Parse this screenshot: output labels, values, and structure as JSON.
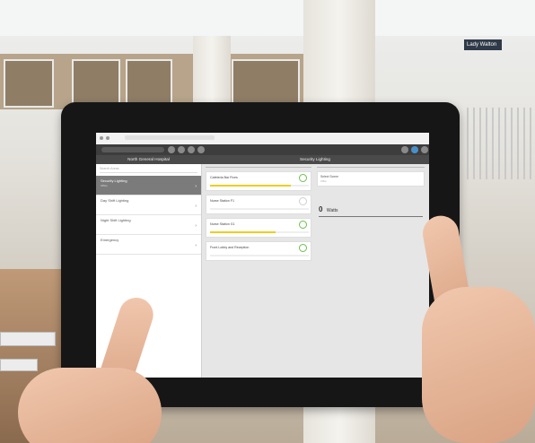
{
  "background_sign": "Lady Walton",
  "app": {
    "browser_url": "",
    "hospital_name": "North General Hospital",
    "panel_title": "Security Lighting",
    "sidebar_search_placeholder": "Search Areas",
    "sidebar_items": [
      {
        "label": "Security Lighting",
        "sub": "Office",
        "active": true
      },
      {
        "label": "Day Shift Lighting",
        "sub": "",
        "active": false
      },
      {
        "label": "Night Shift Lighting",
        "sub": "",
        "active": false
      },
      {
        "label": "Emergency",
        "sub": "",
        "active": false
      }
    ],
    "zones": [
      {
        "label": "Cafeteria Bar Fixes",
        "on": true,
        "level": 0.82
      },
      {
        "label": "Nurse Station F1",
        "on": false,
        "level": 0
      },
      {
        "label": "Nurse Station G1",
        "on": true,
        "level": 0.66
      },
      {
        "label": "Front Lobby and Reception",
        "on": true,
        "level": 0
      }
    ],
    "scene": {
      "label": "Select Scene",
      "sub": "Office"
    },
    "power": {
      "value": "0",
      "unit": "Watts"
    }
  },
  "colors": {
    "accent_green": "#6cc04a",
    "slider_yellow": "#f0cc1e",
    "header_dark": "#3d3d3d"
  }
}
